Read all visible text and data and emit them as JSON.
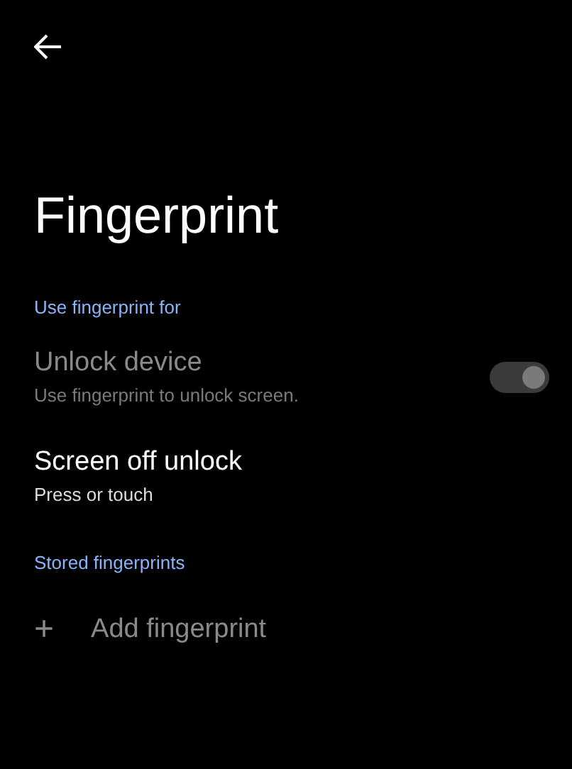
{
  "header": {
    "title": "Fingerprint"
  },
  "sections": [
    {
      "heading": "Use fingerprint for",
      "items": [
        {
          "kind": "switch",
          "title": "Unlock device",
          "subtitle": "Use fingerprint to unlock screen.",
          "disabled": true,
          "on": true
        },
        {
          "kind": "plain",
          "title": "Screen off unlock",
          "subtitle": "Press or touch",
          "disabled": false
        }
      ]
    },
    {
      "heading": "Stored fingerprints",
      "items": [
        {
          "kind": "add",
          "icon": "+",
          "title": "Add fingerprint",
          "disabled": true
        }
      ]
    }
  ]
}
